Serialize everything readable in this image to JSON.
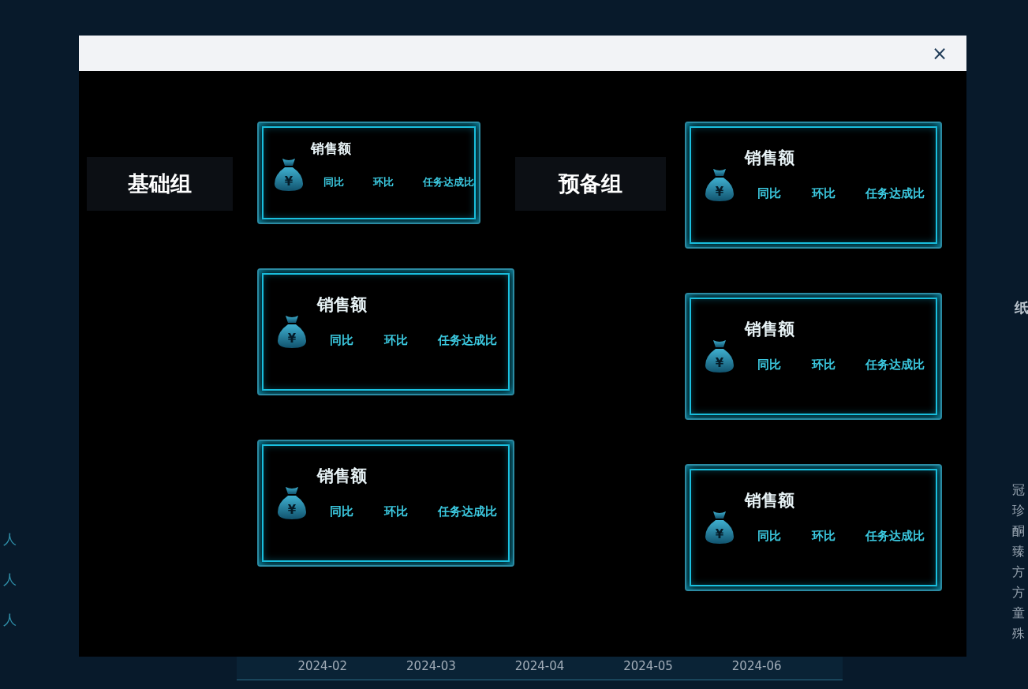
{
  "background": {
    "left_labels": [
      "人",
      "人",
      "人"
    ],
    "right_fragments": [
      "冠",
      "珍",
      "酮",
      "臻",
      "方",
      "方",
      "童",
      "殊"
    ],
    "right_header": "纸",
    "axis_labels": [
      "2024-02",
      "2024-03",
      "2024-04",
      "2024-05",
      "2024-06"
    ]
  },
  "dialog": {
    "close": "×",
    "groups": [
      {
        "label": "基础组",
        "cards": [
          {
            "kind": "compact",
            "icon_glyph": "¥",
            "title": "销售额",
            "metrics": [
              "同比",
              "环比",
              "任务达成比"
            ]
          },
          {
            "kind": "standard",
            "icon_glyph": "¥",
            "title": "销售额",
            "metrics": [
              "同比",
              "环比",
              "任务达成比"
            ]
          },
          {
            "kind": "standard",
            "icon_glyph": "¥",
            "title": "销售额",
            "metrics": [
              "同比",
              "环比",
              "任务达成比"
            ]
          }
        ]
      },
      {
        "label": "预备组",
        "cards": [
          {
            "kind": "standard",
            "icon_glyph": "¥",
            "title": "销售额",
            "metrics": [
              "同比",
              "环比",
              "任务达成比"
            ]
          },
          {
            "kind": "standard",
            "icon_glyph": "¥",
            "title": "销售额",
            "metrics": [
              "同比",
              "环比",
              "任务达成比"
            ]
          },
          {
            "kind": "standard",
            "icon_glyph": "¥",
            "title": "销售额",
            "metrics": [
              "同比",
              "环比",
              "任务达成比"
            ]
          }
        ]
      }
    ]
  }
}
